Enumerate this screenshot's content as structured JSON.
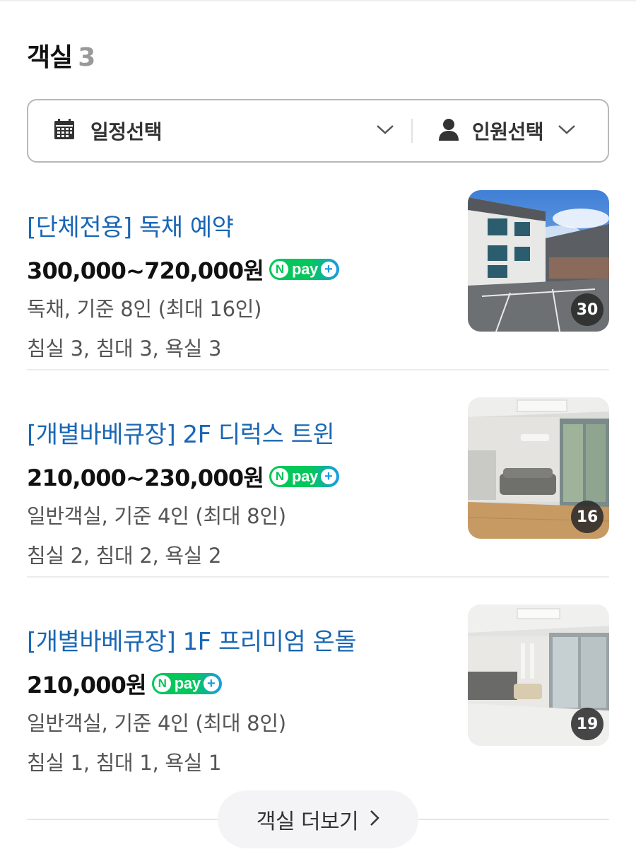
{
  "section": {
    "title": "객실",
    "count": "3"
  },
  "filters": {
    "date": {
      "label": "일정선택",
      "icon": "calendar-icon"
    },
    "people": {
      "label": "인원선택",
      "icon": "person-icon"
    }
  },
  "rooms": [
    {
      "name": "[단체전용] 독채 예약",
      "price": "300,000~720,000원",
      "type_capacity": "독채, 기준 8인 (최대 16인)",
      "facilities": "침실 3, 침대 3, 욕실 3",
      "photo_count": "30",
      "photo_subject": "building-exterior"
    },
    {
      "name": "[개별바베큐장] 2F 디럭스 트윈",
      "price": "210,000~230,000원",
      "type_capacity": "일반객실, 기준 4인 (최대 8인)",
      "facilities": "침실 2, 침대 2, 욕실 2",
      "photo_count": "16",
      "photo_subject": "living-room-sofa"
    },
    {
      "name": "[개별바베큐장] 1F 프리미엄 온돌",
      "price": "210,000원",
      "type_capacity": "일반객실, 기준 4인 (최대 8인)",
      "facilities": "침실 1, 침대 1, 욕실 1",
      "photo_count": "19",
      "photo_subject": "living-room-kitchen"
    }
  ],
  "npay_badge": {
    "n": "N",
    "text": "pay",
    "plus": "+"
  },
  "more_button": {
    "label": "객실 더보기"
  },
  "colors": {
    "room_name": "#1a67b4",
    "npay_green": "#03c75a",
    "npay_blue": "#1a9be6",
    "title_count": "#9a9a9a"
  }
}
